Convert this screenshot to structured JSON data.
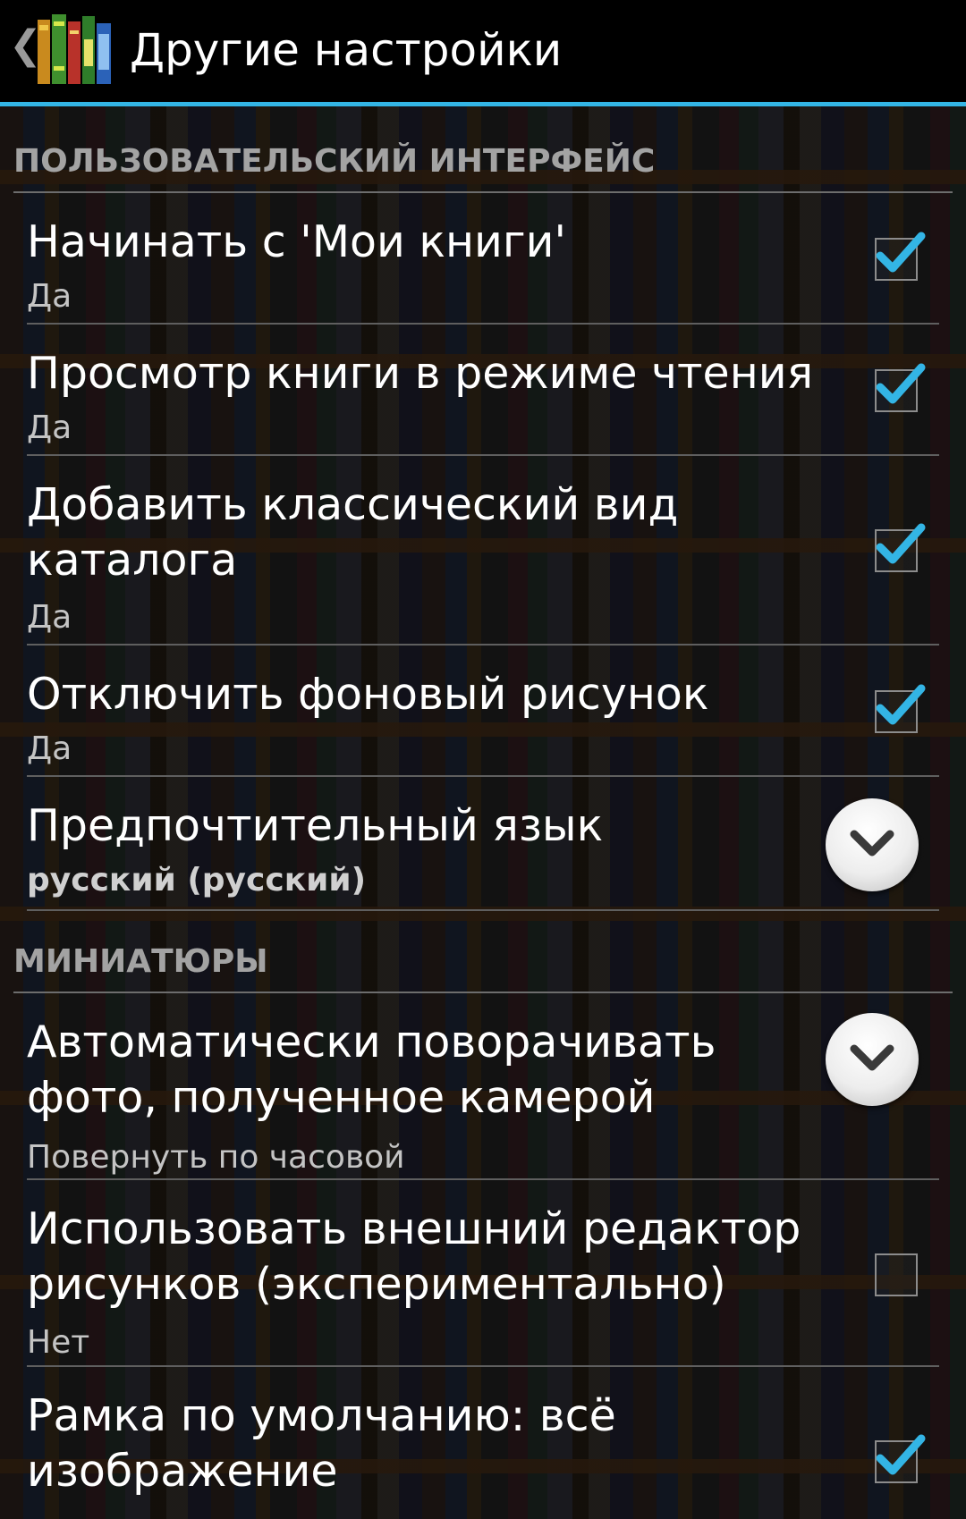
{
  "header": {
    "title": "Другие настройки",
    "up_icon": "chevron-left-icon",
    "app_icon": "books-icon"
  },
  "accent_color": "#33b5e5",
  "sections": [
    {
      "label": "ПОЛЬЗОВАТЕЛЬСКИЙ ИНТЕРФЕЙС",
      "items": [
        {
          "title": "Начинать с 'Мои книги'",
          "summary": "Да",
          "control": "checkbox",
          "checked": true
        },
        {
          "title": "Просмотр книги в режиме чтения",
          "summary": "Да",
          "control": "checkbox",
          "checked": true
        },
        {
          "title": "Добавить классический вид каталога",
          "summary": "Да",
          "control": "checkbox",
          "checked": true
        },
        {
          "title": "Отключить фоновый рисунок",
          "summary": "Да",
          "control": "checkbox",
          "checked": true
        },
        {
          "title": "Предпочтительный язык",
          "summary": "русский (русский)",
          "control": "dropdown"
        }
      ]
    },
    {
      "label": "МИНИАТЮРЫ",
      "items": [
        {
          "title": "Автоматически поворачивать фото, полученное камерой",
          "summary": "Повернуть по часовой",
          "control": "dropdown"
        },
        {
          "title": "Использовать внешний редактор рисунков (экспериментально)",
          "summary": "Нет",
          "control": "checkbox",
          "checked": false
        },
        {
          "title": "Рамка по умолчанию: всё изображение",
          "summary": "",
          "control": "checkbox",
          "checked": true
        }
      ]
    }
  ]
}
